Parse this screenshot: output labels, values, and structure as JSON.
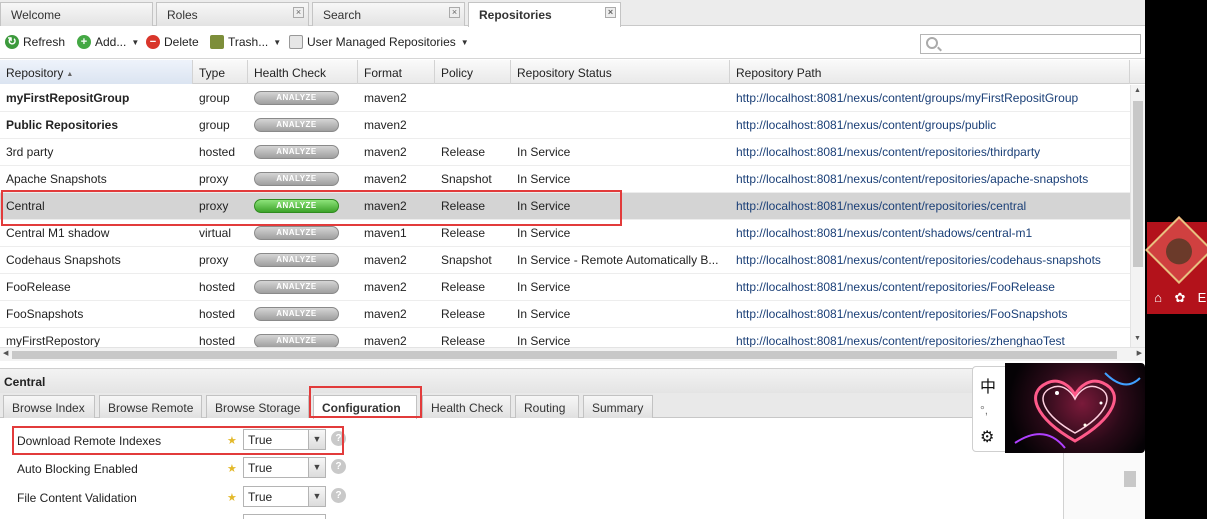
{
  "top_tabs": [
    {
      "label": "Welcome",
      "closable": false
    },
    {
      "label": "Roles",
      "closable": true
    },
    {
      "label": "Search",
      "closable": true
    },
    {
      "label": "Repositories",
      "closable": true,
      "active": true
    }
  ],
  "toolbar": {
    "refresh": "Refresh",
    "add": "Add...",
    "delete": "Delete",
    "trash": "Trash...",
    "user_managed": "User Managed Repositories"
  },
  "grid": {
    "headers": [
      "Repository",
      "Type",
      "Health Check",
      "Format",
      "Policy",
      "Repository Status",
      "Repository Path"
    ],
    "analyze_label": "ANALYZE",
    "rows": [
      {
        "name": "myFirstRepositGroup",
        "bold": true,
        "type": "group",
        "format": "maven2",
        "policy": "",
        "status": "",
        "path": "http://localhost:8081/nexus/content/groups/myFirstRepositGroup"
      },
      {
        "name": "Public Repositories",
        "bold": true,
        "type": "group",
        "format": "maven2",
        "policy": "",
        "status": "",
        "path": "http://localhost:8081/nexus/content/groups/public"
      },
      {
        "name": "3rd party",
        "type": "hosted",
        "format": "maven2",
        "policy": "Release",
        "status": "In Service",
        "path": "http://localhost:8081/nexus/content/repositories/thirdparty"
      },
      {
        "name": "Apache Snapshots",
        "type": "proxy",
        "format": "maven2",
        "policy": "Snapshot",
        "status": "In Service",
        "path": "http://localhost:8081/nexus/content/repositories/apache-snapshots"
      },
      {
        "name": "Central",
        "type": "proxy",
        "format": "maven2",
        "policy": "Release",
        "status": "In Service",
        "path": "http://localhost:8081/nexus/content/repositories/central",
        "selected": true,
        "analyze_active": true
      },
      {
        "name": "Central M1 shadow",
        "type": "virtual",
        "format": "maven1",
        "policy": "Release",
        "status": "In Service",
        "path": "http://localhost:8081/nexus/content/shadows/central-m1"
      },
      {
        "name": "Codehaus Snapshots",
        "type": "proxy",
        "format": "maven2",
        "policy": "Snapshot",
        "status": "In Service - Remote Automatically B...",
        "path": "http://localhost:8081/nexus/content/repositories/codehaus-snapshots"
      },
      {
        "name": "FooRelease",
        "type": "hosted",
        "format": "maven2",
        "policy": "Release",
        "status": "In Service",
        "path": "http://localhost:8081/nexus/content/repositories/FooRelease"
      },
      {
        "name": "FooSnapshots",
        "type": "hosted",
        "format": "maven2",
        "policy": "Release",
        "status": "In Service",
        "path": "http://localhost:8081/nexus/content/repositories/FooSnapshots"
      },
      {
        "name": "myFirstRepostory",
        "type": "hosted",
        "format": "maven2",
        "policy": "Release",
        "status": "In Service",
        "path": "http://localhost:8081/nexus/content/repositories/zhenghaoTest"
      }
    ]
  },
  "detail": {
    "title": "Central",
    "tabs": [
      "Browse Index",
      "Browse Remote",
      "Browse Storage",
      "Configuration",
      "Health Check",
      "Routing",
      "Summary"
    ],
    "active_tab": "Configuration",
    "fields": [
      {
        "label": "Download Remote Indexes",
        "value": "True"
      },
      {
        "label": "Auto Blocking Enabled",
        "value": "True"
      },
      {
        "label": "File Content Validation",
        "value": "True"
      }
    ]
  },
  "ime": {
    "char1": "中",
    "char2": "°,"
  },
  "colors": {
    "highlight": "#e23b3b",
    "analyze_active": "#3da32a",
    "selected_row": "#d4d4d4",
    "required_star": "#e3b92a"
  }
}
